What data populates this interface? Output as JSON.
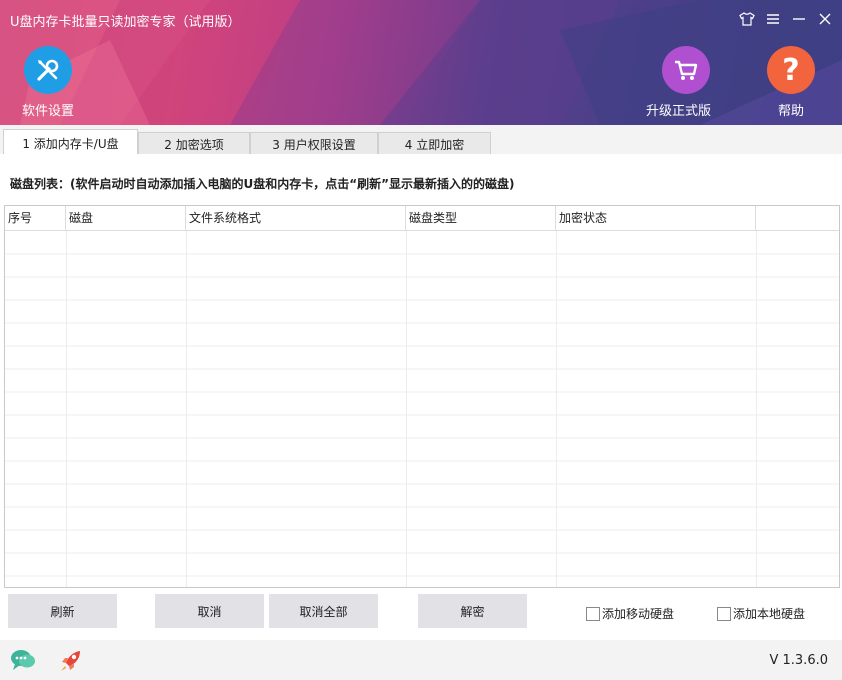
{
  "window": {
    "title": "U盘内存卡批量只读加密专家（试用版）",
    "controls": [
      "shirt-icon",
      "menu-icon",
      "minimize-icon",
      "close-icon"
    ]
  },
  "header": {
    "settings_label": "软件设置",
    "upgrade_label": "升级正式版",
    "help_label": "帮助"
  },
  "tabs": [
    {
      "label": "1 添加内存卡/U盘",
      "active": true
    },
    {
      "label": "2 加密选项",
      "active": false
    },
    {
      "label": "3 用户权限设置",
      "active": false
    },
    {
      "label": "4 立即加密",
      "active": false
    }
  ],
  "list": {
    "caption": "磁盘列表：(软件启动时自动添加插入电脑的U盘和内存卡，点击“刷新”显示最新插入的的磁盘)",
    "columns": [
      "序号",
      "磁盘",
      "文件系统格式",
      "磁盘类型",
      "加密状态"
    ],
    "rows": []
  },
  "buttons": {
    "refresh": "刷新",
    "cancel": "取消",
    "cancel_all": "取消全部",
    "decrypt": "解密"
  },
  "checkboxes": {
    "add_removable": {
      "label": "添加移动硬盘",
      "checked": false
    },
    "add_local": {
      "label": "添加本地硬盘",
      "checked": false
    }
  },
  "footer": {
    "version": "V 1.3.6.0"
  },
  "colors": {
    "settings_icon_bg": "#1f9ee6",
    "upgrade_icon_bg": "#b14fd1",
    "help_icon_bg": "#f2643e",
    "chat_icon": "#3fb39a",
    "rocket_icon": "#e8453c"
  }
}
